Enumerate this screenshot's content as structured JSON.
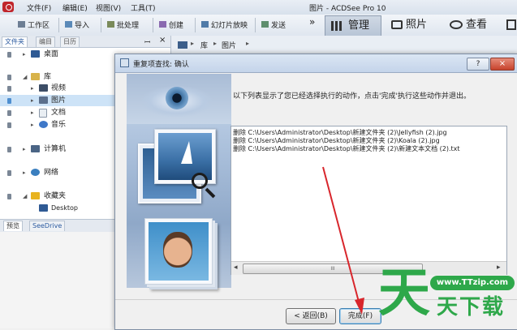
{
  "window_title": "图片 - ACDSee Pro 10",
  "menu": [
    "文件(F)",
    "编辑(E)",
    "视图(V)",
    "工具(T)"
  ],
  "toolbar": {
    "items": [
      "工作区",
      "导入",
      "批处理",
      "创建",
      "幻灯片放映",
      "发送"
    ],
    "more": "»",
    "modes": [
      "管理",
      "照片",
      "查看"
    ]
  },
  "left_panel": {
    "tabs": [
      "文件夹",
      "编目",
      "日历"
    ],
    "pin": "ꟷ",
    "close": "×",
    "tree": {
      "desktop": "桌面",
      "library": "库",
      "videos": "视频",
      "pictures": "图片",
      "documents": "文档",
      "music": "音乐",
      "computer": "计算机",
      "network": "网络",
      "favorites": "收藏夹",
      "fav_desktop": "Desktop"
    },
    "bottom_tabs": [
      "预览",
      "SeeDrive"
    ]
  },
  "breadcrumb": [
    "库",
    "图片"
  ],
  "dialog": {
    "title": "重复项查找: 确认",
    "help": "?",
    "close": "×",
    "message": "以下列表显示了您已经选择执行的动作，点击'完成'执行这些动作并退出。",
    "actions": [
      "删除 C:\\Users\\Administrator\\Desktop\\新建文件夹 (2)\\Jellyfish (2).jpg",
      "删除 C:\\Users\\Administrator\\Desktop\\新建文件夹 (2)\\Koala (2).jpg",
      "删除 C:\\Users\\Administrator\\Desktop\\新建文件夹 (2)\\新建文本文档 (2).txt"
    ],
    "scroll_left": "◂",
    "scroll_right": "▸",
    "scroll_thumb": "III",
    "back_button": "< 返回(B)",
    "finish_button": "完成(F)"
  },
  "watermark": {
    "url": "www.TTzip.com",
    "big": "天",
    "text": "天下载"
  },
  "colors": {
    "accent_red": "#d8262c",
    "watermark_green": "#2ea84a",
    "selection": "#cde3f7"
  }
}
